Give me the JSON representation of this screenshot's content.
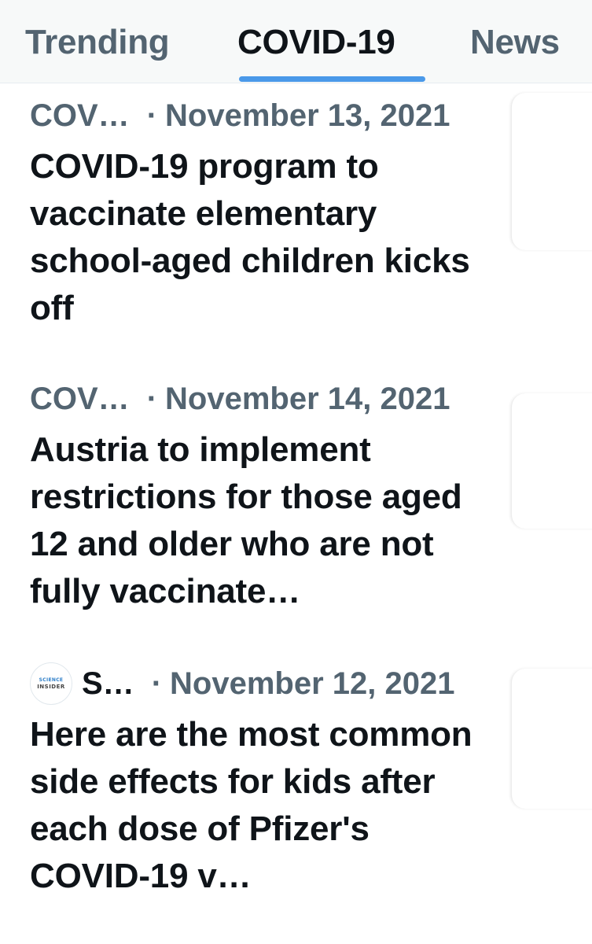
{
  "tabs": [
    {
      "label": "Trending"
    },
    {
      "label": "COVID-19"
    },
    {
      "label": "News"
    }
  ],
  "active_tab": "COVID-19",
  "colors": {
    "accent": "#4a99e9",
    "text_primary": "#0f1419",
    "text_secondary": "#536471"
  },
  "articles": [
    {
      "source": "COV…",
      "separator": "·",
      "date": "November 13, 2021",
      "headline": "COVID-19 program to vaccinate elementary school-aged children kicks off",
      "thumbnail": "thumbnail-image"
    },
    {
      "source": "COV…",
      "separator": "·",
      "date": "November 14, 2021",
      "headline": "Austria to implement restrictions for those aged 12 and older who are not fully vaccinate…",
      "thumbnail": "thumbnail-image"
    },
    {
      "source": "S…",
      "source_logo": {
        "top": "SCIENCE",
        "bottom": "INSIDER"
      },
      "separator": "·",
      "date": "November 12, 2021",
      "headline": "Here are the most common side effects for kids after each dose of Pfizer's COVID-19 v…",
      "thumbnail": "thumbnail-image"
    }
  ]
}
